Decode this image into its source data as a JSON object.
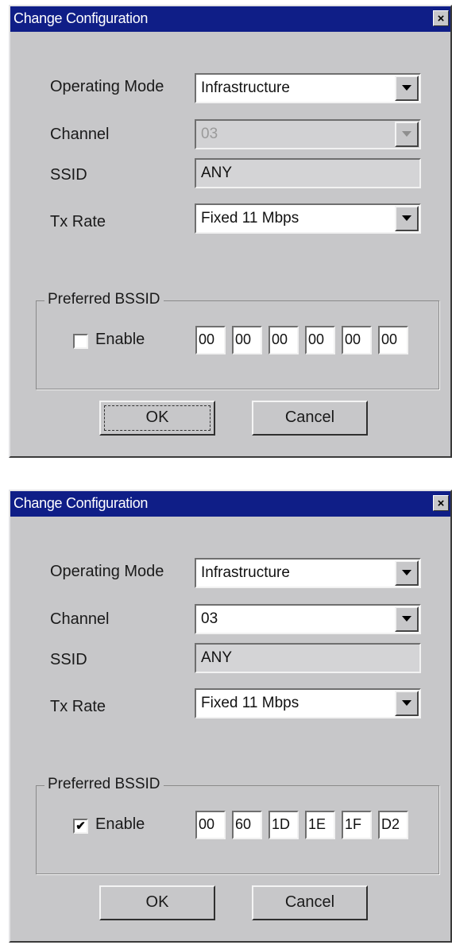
{
  "dialogs": [
    {
      "title": "Change Configuration",
      "close_glyph": "×",
      "fields": {
        "operating_mode": {
          "label": "Operating Mode",
          "value": "Infrastructure"
        },
        "channel": {
          "label": "Channel",
          "value": "03",
          "enabled": false
        },
        "ssid": {
          "label": "SSID",
          "value": "ANY"
        },
        "tx_rate": {
          "label": "Tx Rate",
          "value": "Fixed 11 Mbps"
        }
      },
      "preferred_bssid": {
        "group_label": "Preferred BSSID",
        "enable_label": "Enable",
        "enable_checked": false,
        "check_glyph": "",
        "octets": [
          "00",
          "00",
          "00",
          "00",
          "00",
          "00"
        ]
      },
      "buttons": {
        "ok": "OK",
        "cancel": "Cancel"
      }
    },
    {
      "title": "Change Configuration",
      "close_glyph": "×",
      "fields": {
        "operating_mode": {
          "label": "Operating Mode",
          "value": "Infrastructure"
        },
        "channel": {
          "label": "Channel",
          "value": "03",
          "enabled": true
        },
        "ssid": {
          "label": "SSID",
          "value": "ANY"
        },
        "tx_rate": {
          "label": "Tx Rate",
          "value": "Fixed 11 Mbps"
        }
      },
      "preferred_bssid": {
        "group_label": "Preferred BSSID",
        "enable_label": "Enable",
        "enable_checked": true,
        "check_glyph": "✔",
        "octets": [
          "00",
          "60",
          "1D",
          "1E",
          "1F",
          "D2"
        ]
      },
      "buttons": {
        "ok": "OK",
        "cancel": "Cancel"
      }
    }
  ],
  "colors": {
    "titlebar": "#0f1e87",
    "dialog_face": "#c7c7c9",
    "field_bg": "#ffffff",
    "disabled_field_bg": "#d2d2d4"
  },
  "icons": {
    "close": "close-icon",
    "dropdown": "chevron-down-icon",
    "check": "checkmark-icon"
  }
}
